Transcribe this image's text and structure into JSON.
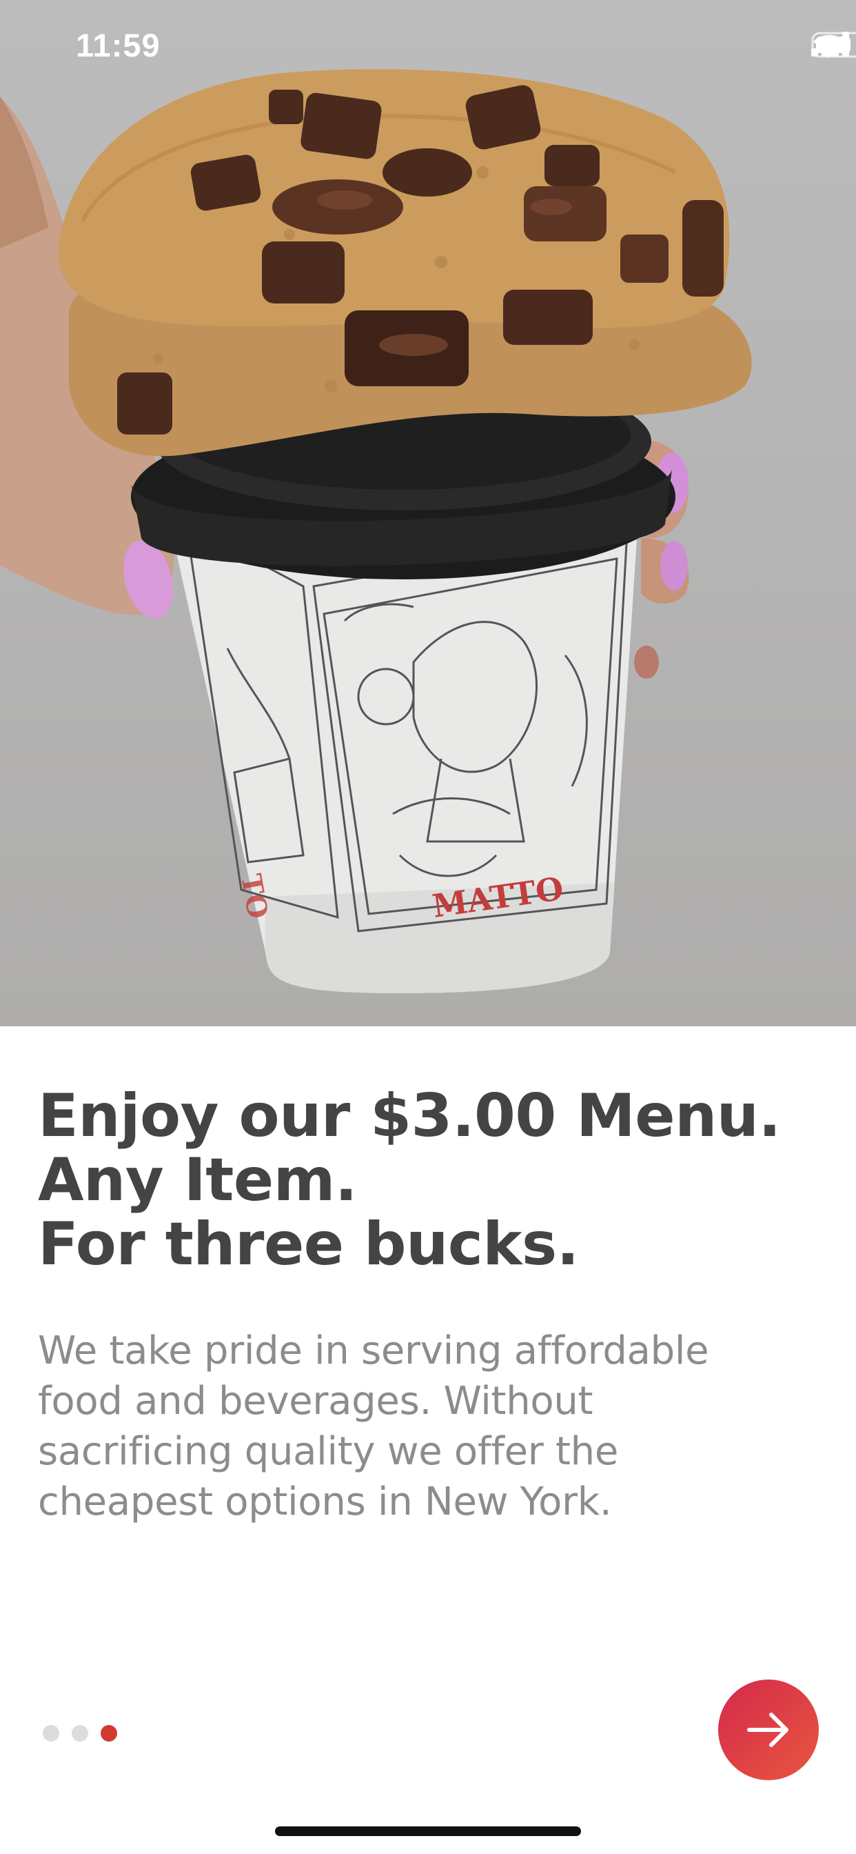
{
  "status_bar": {
    "time": "11:59",
    "icons": [
      "cellular-signal-icon",
      "wifi-icon",
      "battery-icon"
    ]
  },
  "hero": {
    "cup_brand_text": "MATTO",
    "description": "photo"
  },
  "onboarding": {
    "headline_lines": [
      "Enjoy our $3.00 Menu.",
      "Any Item.",
      "For three bucks."
    ],
    "body_lines": [
      "We take pride in serving affordable",
      "food and beverages. Without",
      "sacrificing quality we offer the",
      "cheapest options in New York."
    ],
    "page_count": 3,
    "active_page": 3,
    "next_button_icon": "arrow-right-icon"
  },
  "colors": {
    "headline": "#444444",
    "body": "#8c8c8c",
    "active_dot": "#d23a30",
    "inactive_dot": "#dcdcdc",
    "button_gradient_start": "#d42a4c",
    "button_gradient_end": "#e8563f"
  }
}
